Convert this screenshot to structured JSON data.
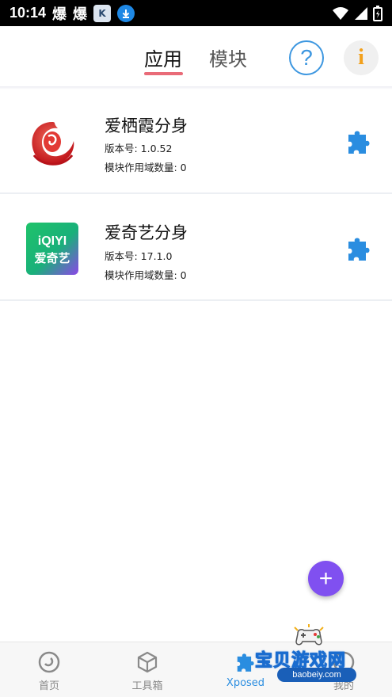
{
  "status_bar": {
    "time": "10:14",
    "notification_icons": [
      "fire-icon",
      "fire-icon",
      "app-icon",
      "download-icon"
    ],
    "notif_glyph": "爆",
    "app_glyph": "K",
    "system_icons": [
      "wifi-icon",
      "signal-icon",
      "battery-icon"
    ]
  },
  "header": {
    "tabs": [
      {
        "label": "应用",
        "active": true
      },
      {
        "label": "模块",
        "active": false
      }
    ],
    "help_label": "?",
    "info_label": "i"
  },
  "apps": [
    {
      "name": "爱栖霞分身",
      "version": "版本号: 1.0.52",
      "scope": "模块作用域数量: 0",
      "icon": "aiqixia-logo-icon"
    },
    {
      "name": "爱奇艺分身",
      "version": "版本号: 17.1.0",
      "scope": "模块作用域数量: 0",
      "icon": "iqiyi-logo-icon",
      "icon_text_top": "iQIYI",
      "icon_text_bottom": "爱奇艺"
    }
  ],
  "fab": {
    "label": "+"
  },
  "bottom_nav": [
    {
      "label": "首页",
      "icon": "home-disc-icon",
      "active": false
    },
    {
      "label": "工具箱",
      "icon": "toolbox-cube-icon",
      "active": false
    },
    {
      "label": "Xposed",
      "icon": "puzzle-icon",
      "active": true
    },
    {
      "label": "我的",
      "icon": "profile-icon",
      "active": false
    }
  ],
  "watermark": {
    "text": "宝贝游戏网",
    "url": "baobeiy.com"
  },
  "colors": {
    "accent_blue": "#2a8de0",
    "tab_underline": "#e96b78",
    "fab_purple": "#8050f0",
    "info_orange": "#f2a01c"
  }
}
